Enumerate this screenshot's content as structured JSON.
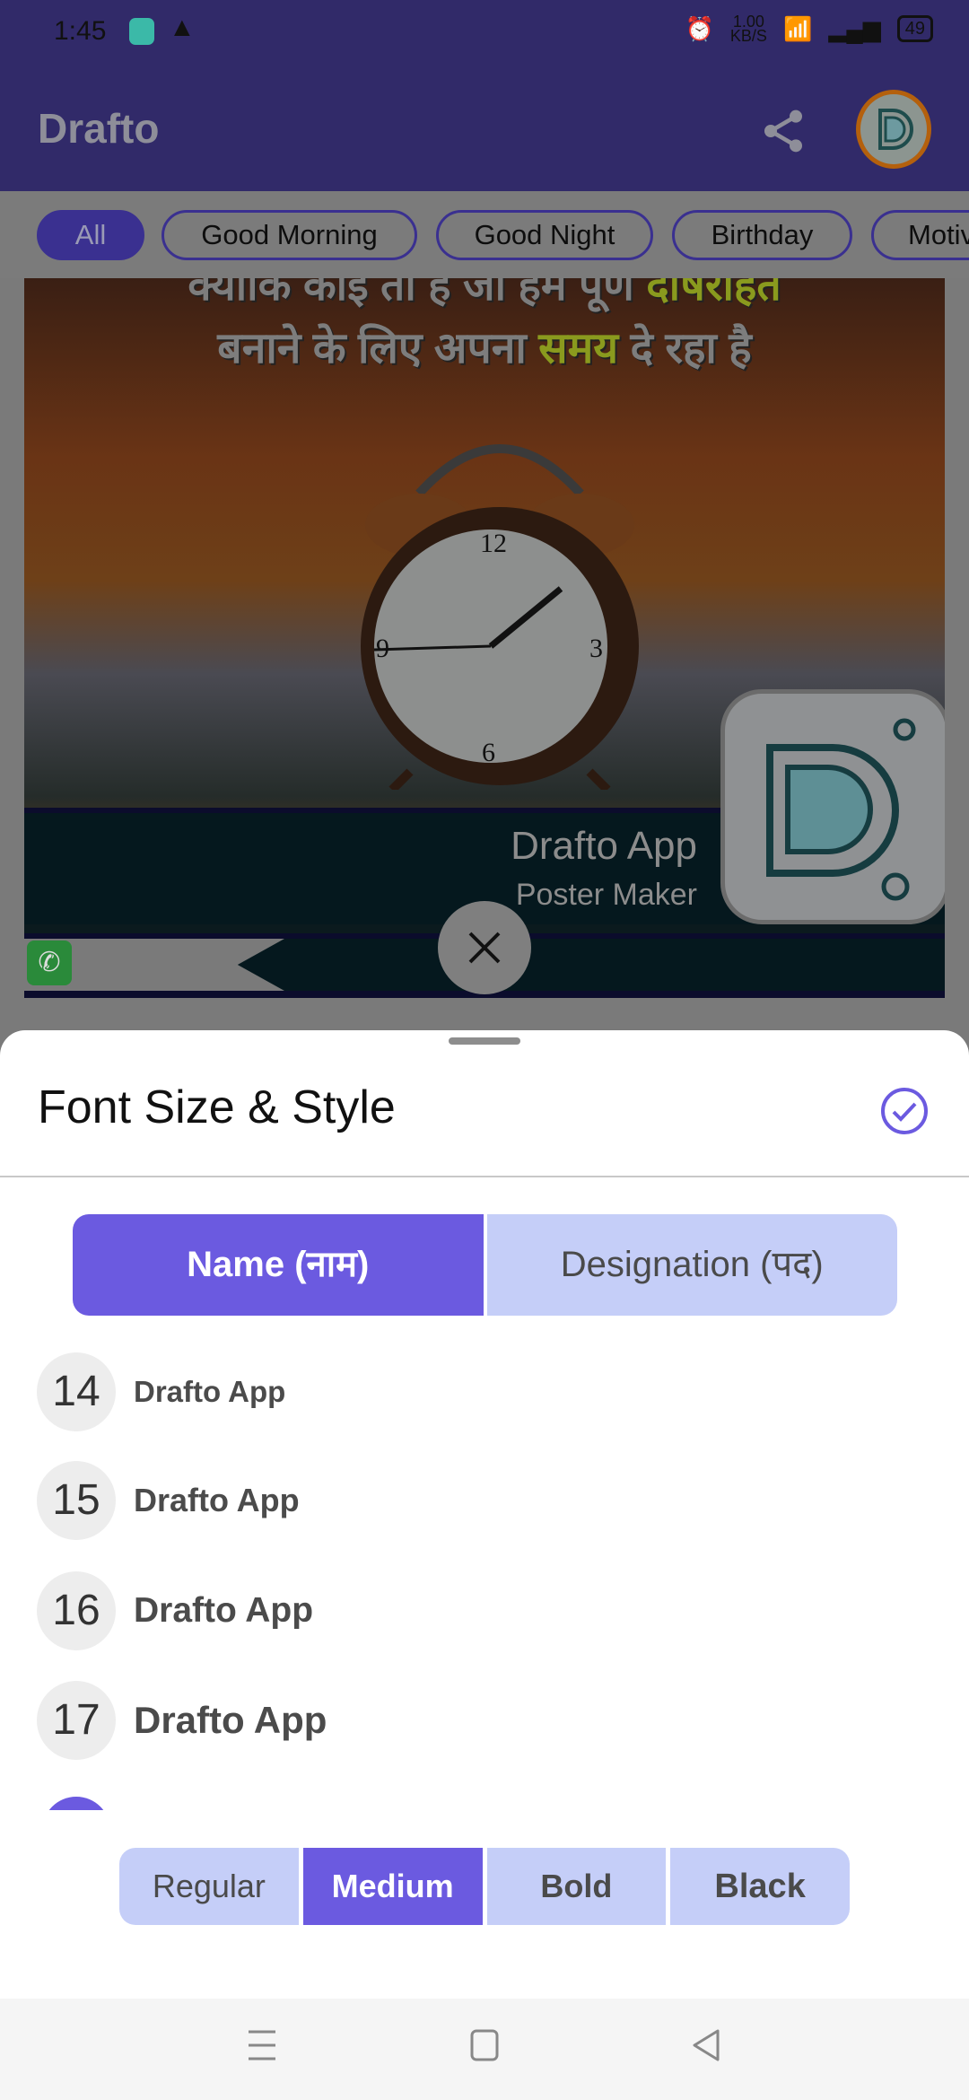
{
  "status_bar": {
    "time": "1:45",
    "net_speed": "1.00",
    "net_unit": "KB/S",
    "battery": "49"
  },
  "app_bar": {
    "title": "Drafto",
    "share_icon": "share-icon"
  },
  "chips": [
    {
      "label": "All",
      "active": true
    },
    {
      "label": "Good Morning"
    },
    {
      "label": "Good Night"
    },
    {
      "label": "Birthday"
    },
    {
      "label": "Motiv"
    }
  ],
  "poster": {
    "line1": "क्योंकि कोई तो है जो हमें पूर्ण ",
    "line1_hl": "दोषरहित",
    "line2a": "बनाने के लिए अपना ",
    "line2_hl": "समय",
    "line2b": " दे रहा है",
    "name": "Drafto App",
    "designation": "Poster Maker"
  },
  "sheet": {
    "title": "Font Size & Style",
    "tabs": [
      {
        "label": "Name (नाम)",
        "active": true
      },
      {
        "label": "Designation (पद)"
      }
    ],
    "sizes": [
      {
        "size": "14",
        "text": "Drafto App"
      },
      {
        "size": "15",
        "text": "Drafto App"
      },
      {
        "size": "16",
        "text": "Drafto App"
      },
      {
        "size": "17",
        "text": "Drafto App"
      }
    ],
    "styles": [
      {
        "label": "Regular"
      },
      {
        "label": "Medium",
        "active": true
      },
      {
        "label": "Bold"
      },
      {
        "label": "Black"
      }
    ]
  },
  "colors": {
    "accent": "#6b5ae0",
    "tab_inactive": "#c5cef8",
    "app_bar": "#5b4fd1"
  }
}
